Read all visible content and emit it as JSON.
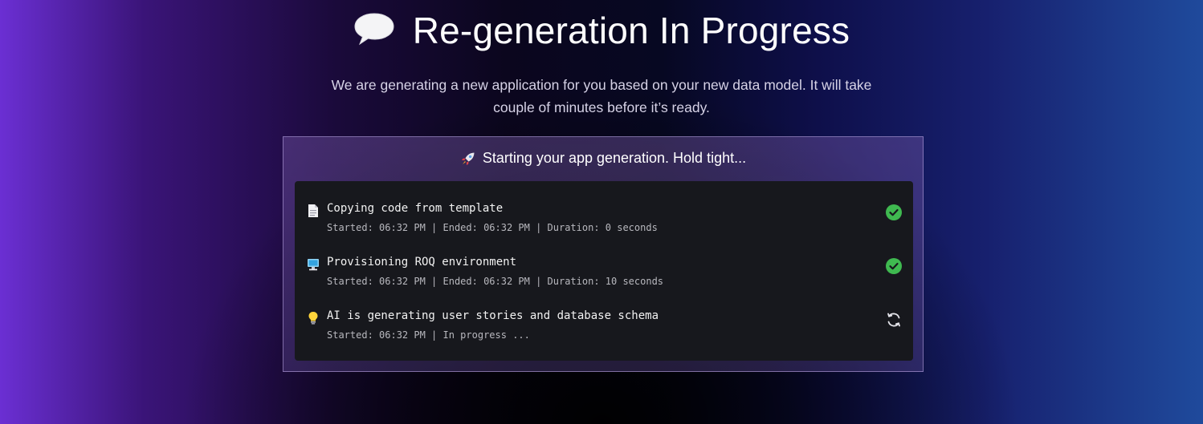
{
  "header": {
    "title": "Re-generation In Progress",
    "title_icon": "speech-bubble-icon",
    "subtitle": "We are generating a new application for you based on your new data model. It will take couple of minutes before it’s ready."
  },
  "panel": {
    "heading": "Starting your app generation. Hold tight...",
    "heading_icon": "rocket-icon",
    "steps": [
      {
        "icon": "document-icon",
        "title": "Copying code from template",
        "meta": "Started: 06:32 PM | Ended: 06:32 PM | Duration: 0 seconds",
        "status": "completed",
        "status_icon": "check-circle-icon"
      },
      {
        "icon": "computer-icon",
        "title": "Provisioning ROQ environment",
        "meta": "Started: 06:32 PM | Ended: 06:32 PM | Duration: 10 seconds",
        "status": "completed",
        "status_icon": "check-circle-icon"
      },
      {
        "icon": "lightbulb-icon",
        "title": "AI is generating user stories and database schema",
        "meta": "Started: 06:32 PM | In progress ...",
        "status": "in-progress",
        "status_icon": "refresh-icon"
      }
    ]
  },
  "colors": {
    "success": "#3fb950",
    "log_background": "#17181d",
    "accent_purple": "#6b2fd3",
    "accent_blue": "#1f4a9c"
  }
}
